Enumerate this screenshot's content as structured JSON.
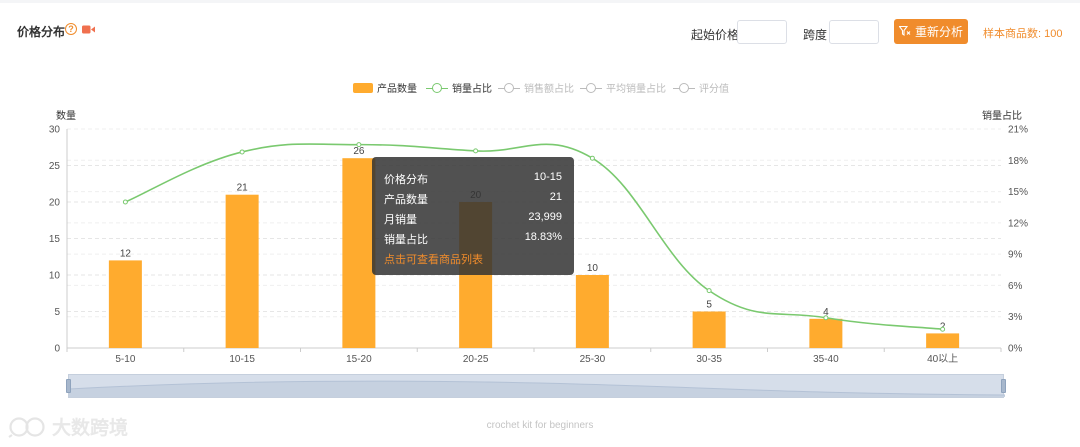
{
  "header": {
    "title": "价格分布",
    "help_glyph": "?",
    "start_price_label": "起始价格",
    "start_price_value": "",
    "span_label": "跨度",
    "span_value": "",
    "reanalyze_label": "重新分析",
    "sample_count": "样本商品数: 100"
  },
  "legend": [
    {
      "label": "产品数量",
      "kind": "bar",
      "active": true
    },
    {
      "label": "销量占比",
      "kind": "line",
      "active": true
    },
    {
      "label": "销售额占比",
      "kind": "line",
      "active": false
    },
    {
      "label": "平均销量占比",
      "kind": "line",
      "active": false
    },
    {
      "label": "评分值",
      "kind": "line",
      "active": false
    }
  ],
  "tooltip": {
    "rows": [
      {
        "label": "价格分布",
        "value": "10-15"
      },
      {
        "label": "产品数量",
        "value": "21"
      },
      {
        "label": "月销量",
        "value": "23,999"
      },
      {
        "label": "销量占比",
        "value": "18.83%"
      }
    ],
    "link": "点击可查看商品列表"
  },
  "chart_data": {
    "type": "bar",
    "categories": [
      "5-10",
      "10-15",
      "15-20",
      "20-25",
      "25-30",
      "30-35",
      "35-40",
      "40以上"
    ],
    "ylabel": "数量",
    "y2label": "销量占比",
    "ylim": [
      0,
      30
    ],
    "yticks": [
      0,
      5,
      10,
      15,
      20,
      25,
      30
    ],
    "y2lim": [
      0,
      21
    ],
    "y2ticks": [
      "0%",
      "3%",
      "6%",
      "9%",
      "12%",
      "15%",
      "18%",
      "21%"
    ],
    "grid": true,
    "legend_position": "top-center",
    "series": [
      {
        "name": "产品数量",
        "kind": "bar",
        "axis": "left",
        "values": [
          12,
          21,
          26,
          20,
          10,
          5,
          4,
          2
        ],
        "color": "#ffab2e"
      },
      {
        "name": "销量占比",
        "kind": "line",
        "axis": "right",
        "values": [
          14.0,
          18.8,
          19.5,
          18.9,
          18.2,
          5.5,
          2.9,
          1.8
        ],
        "color": "#7ac96f"
      }
    ]
  },
  "logo_text": "大数跨境",
  "footer_keyword": "crochet kit for beginners",
  "colors": {
    "accent": "#f08c2c",
    "bar": "#ffab2e",
    "line": "#7ac96f"
  }
}
